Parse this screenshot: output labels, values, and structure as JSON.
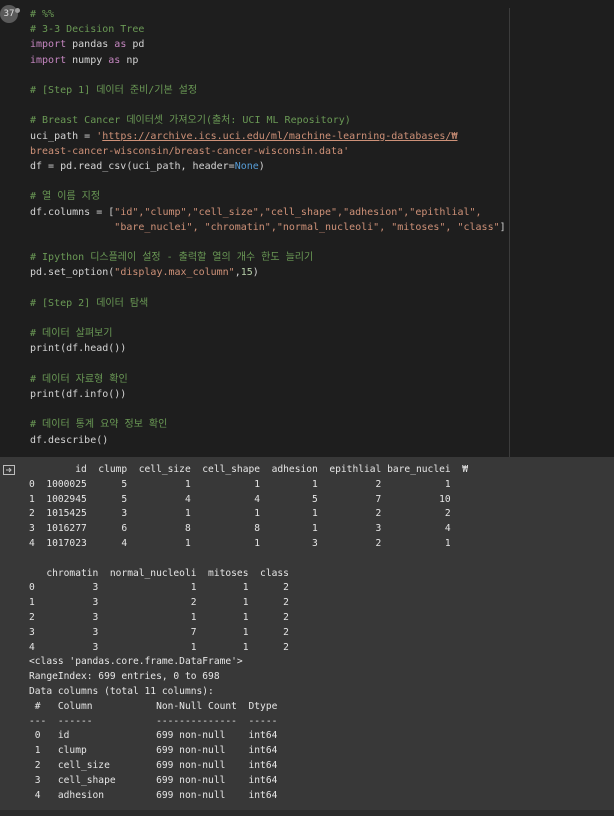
{
  "execution_count": "37",
  "code_lines": [
    [
      {
        "t": "# %%",
        "c": "comment"
      }
    ],
    [
      {
        "t": "# 3-3 Decision Tree",
        "c": "comment"
      }
    ],
    [
      {
        "t": "import",
        "c": "kw"
      },
      {
        "t": " pandas ",
        "c": ""
      },
      {
        "t": "as",
        "c": "kw"
      },
      {
        "t": " pd",
        "c": ""
      }
    ],
    [
      {
        "t": "import",
        "c": "kw"
      },
      {
        "t": " numpy ",
        "c": ""
      },
      {
        "t": "as",
        "c": "kw"
      },
      {
        "t": " np",
        "c": ""
      }
    ],
    [
      {
        "t": "",
        "c": ""
      }
    ],
    [
      {
        "t": "# [Step 1] 데이터 준비/기본 설정",
        "c": "comment"
      }
    ],
    [
      {
        "t": "",
        "c": ""
      }
    ],
    [
      {
        "t": "# Breast Cancer 데이터셋 가져오기(출처: UCI ML Repository)",
        "c": "comment"
      }
    ],
    [
      {
        "t": "uci_path = ",
        "c": ""
      },
      {
        "t": "'",
        "c": "str"
      },
      {
        "t": "https://archive.ics.uci.edu/ml/machine-learning-databases/₩",
        "c": "link"
      }
    ],
    [
      {
        "t": "breast-cancer-wisconsin/breast-cancer-wisconsin.data'",
        "c": "str"
      }
    ],
    [
      {
        "t": "df = pd.read_csv(uci_path, header=",
        "c": ""
      },
      {
        "t": "None",
        "c": "none"
      },
      {
        "t": ")",
        "c": ""
      }
    ],
    [
      {
        "t": "",
        "c": ""
      }
    ],
    [
      {
        "t": "# 열 이름 지정",
        "c": "comment"
      }
    ],
    [
      {
        "t": "df.columns = [",
        "c": ""
      },
      {
        "t": "\"id\",\"clump\",\"cell_size\",\"cell_shape\",\"adhesion\",\"epithlial\",",
        "c": "str"
      }
    ],
    [
      {
        "t": "              ",
        "c": ""
      },
      {
        "t": "\"bare_nuclei\", \"chromatin\",\"normal_nucleoli\", \"mitoses\", \"class\"",
        "c": "str"
      },
      {
        "t": "]",
        "c": ""
      }
    ],
    [
      {
        "t": "",
        "c": ""
      }
    ],
    [
      {
        "t": "# Ipython 디스플레이 설정 - 출력할 열의 개수 한도 늘리기",
        "c": "comment"
      }
    ],
    [
      {
        "t": "pd.set_option(",
        "c": ""
      },
      {
        "t": "\"display.max_column\"",
        "c": "str"
      },
      {
        "t": ",",
        "c": ""
      },
      {
        "t": "15",
        "c": "num"
      },
      {
        "t": ")",
        "c": ""
      }
    ],
    [
      {
        "t": "",
        "c": ""
      }
    ],
    [
      {
        "t": "# [Step 2] 데이터 탐색",
        "c": "comment"
      }
    ],
    [
      {
        "t": "",
        "c": ""
      }
    ],
    [
      {
        "t": "# 데이터 살펴보기",
        "c": "comment"
      }
    ],
    [
      {
        "t": "print(df.head())",
        "c": ""
      }
    ],
    [
      {
        "t": "",
        "c": ""
      }
    ],
    [
      {
        "t": "# 데이터 자료형 확인",
        "c": "comment"
      }
    ],
    [
      {
        "t": "print(df.info())",
        "c": ""
      }
    ],
    [
      {
        "t": "",
        "c": ""
      }
    ],
    [
      {
        "t": "# 데이터 통계 요약 정보 확인",
        "c": "comment"
      }
    ],
    [
      {
        "t": "df.describe()",
        "c": ""
      }
    ]
  ],
  "output_lines": [
    "        id  clump  cell_size  cell_shape  adhesion  epithlial bare_nuclei  ₩",
    "0  1000025      5          1           1         1          2           1",
    "1  1002945      5          4           4         5          7          10",
    "2  1015425      3          1           1         1          2           2",
    "3  1016277      6          8           8         1          3           4",
    "4  1017023      4          1           1         3          2           1",
    "",
    "   chromatin  normal_nucleoli  mitoses  class",
    "0          3                1        1      2",
    "1          3                2        1      2",
    "2          3                1        1      2",
    "3          3                7        1      2",
    "4          3                1        1      2",
    "<class 'pandas.core.frame.DataFrame'>",
    "RangeIndex: 699 entries, 0 to 698",
    "Data columns (total 11 columns):",
    " #   Column           Non-Null Count  Dtype",
    "---  ------           --------------  -----",
    " 0   id               699 non-null    int64",
    " 1   clump            699 non-null    int64",
    " 2   cell_size        699 non-null    int64",
    " 3   cell_shape       699 non-null    int64",
    " 4   adhesion         699 non-null    int64"
  ],
  "colors": {
    "editor_bg": "#1e1e1e",
    "output_bg": "#383838",
    "comment": "#6a9955",
    "keyword": "#c586c0",
    "string": "#ce9178",
    "constant": "#569cd6"
  }
}
